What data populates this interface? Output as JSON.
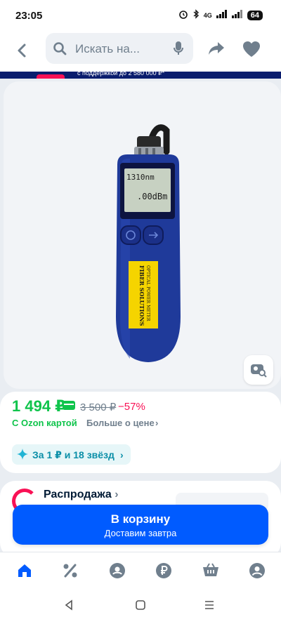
{
  "status_bar": {
    "time": "23:05",
    "network": "4G",
    "battery": "64"
  },
  "top_bar": {
    "search_placeholder": "Искать на..."
  },
  "banner": {
    "text": "с поддержкой до 2 580 000 ₽*"
  },
  "product": {
    "device_labels": [
      "FIBER SOLUTIONS",
      "OPTICAL POWER METER"
    ],
    "display_reading_top": "1310nm",
    "display_reading_bottom": ".00dBm"
  },
  "price": {
    "main": "1 494 ₽",
    "old": "3 500 ₽",
    "discount": "−57%",
    "card_note": "С Ozon картой",
    "more_price": "Больше о цене",
    "more_price_chevron": "›",
    "stars_offer": "За 1 ₽ и 18 звёзд",
    "stars_chevron": "›"
  },
  "seller": {
    "title": "Распродажа",
    "title_chevron": "›"
  },
  "cart_button": {
    "label": "В корзину",
    "sublabel": "Доставим завтра"
  },
  "bottom_nav": {
    "items": [
      "home-icon",
      "discount-icon",
      "profile-circle-icon",
      "ruble-icon",
      "cart-icon",
      "account-icon"
    ]
  },
  "colors": {
    "accent": "#005bff",
    "price_green": "#10c44c",
    "discount_pink": "#f91155",
    "device_blue": "#1f3a9a"
  }
}
